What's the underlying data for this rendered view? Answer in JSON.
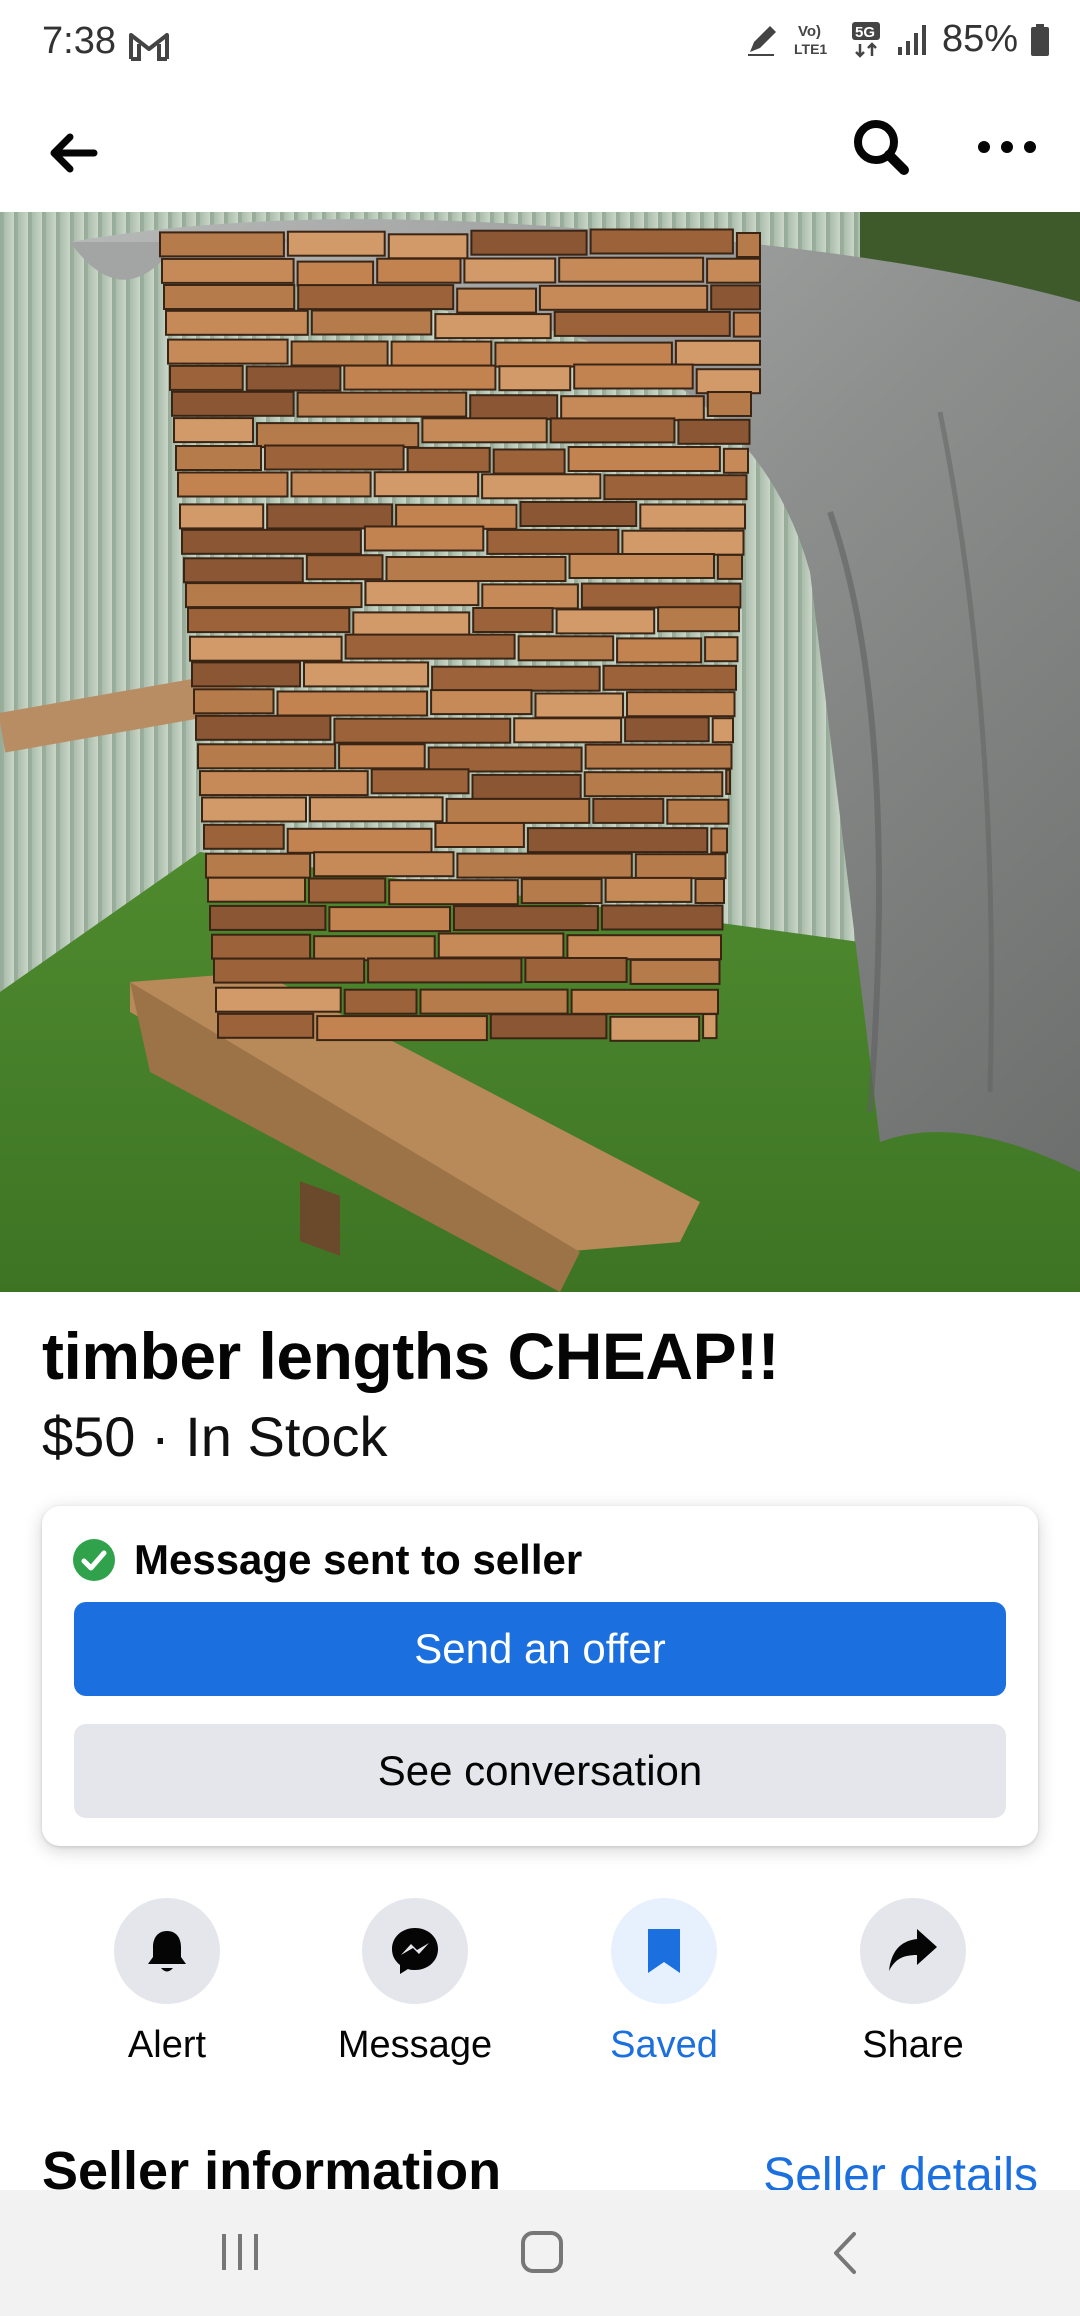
{
  "status_bar": {
    "time": "7:38",
    "network_volte": "Vo)\nLTE1",
    "network_type": "5G",
    "battery": "85%",
    "icons": [
      "gmail-icon",
      "pen-icon",
      "volte-icon",
      "5g-icon",
      "signal-icon",
      "battery-icon"
    ]
  },
  "top_bar": {
    "icons": [
      "back-arrow-icon",
      "search-icon",
      "more-icon"
    ]
  },
  "listing": {
    "title": "timber lengths CHEAP!!",
    "price_line": "$50 · In Stock",
    "photo_icon": "timber-stack-photo"
  },
  "message_card": {
    "status_text": "Message sent to seller",
    "offer_button": "Send an offer",
    "conversation_button": "See conversation",
    "colors": {
      "primary": "#1b6fde",
      "success": "#31a24c",
      "secondary_bg": "#e4e6eb"
    }
  },
  "actions": [
    {
      "label": "Alert",
      "icon": "bell-icon",
      "active": false
    },
    {
      "label": "Message",
      "icon": "messenger-icon",
      "active": false
    },
    {
      "label": "Saved",
      "icon": "bookmark-icon",
      "active": true
    },
    {
      "label": "Share",
      "icon": "share-arrow-icon",
      "active": false
    }
  ],
  "seller_section": {
    "heading": "Seller information",
    "link": "Seller details"
  },
  "nav_bar": {
    "icons": [
      "recent-apps-icon",
      "home-icon",
      "system-back-icon"
    ]
  }
}
